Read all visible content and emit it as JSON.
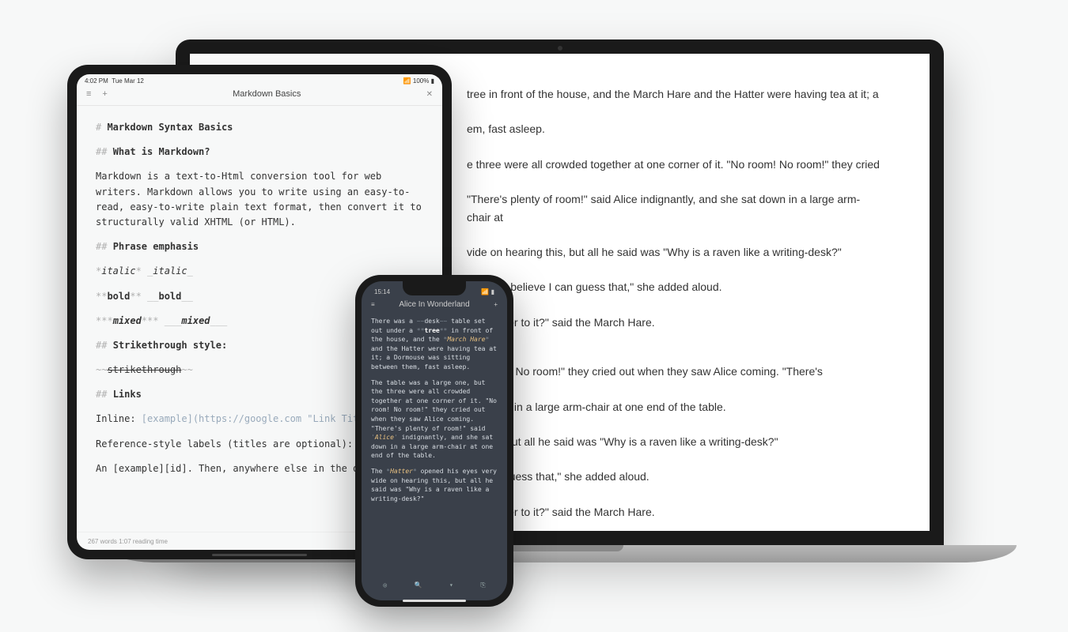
{
  "mac": {
    "p1": "tree in front of the house, and the March Hare and the Hatter were having tea at it; a",
    "p2": "em, fast asleep.",
    "p3": "e three were all crowded together at one corner of it. \"No room! No room!\" they cried",
    "p4": "\"There's plenty of room!\" said Alice indignantly, and she sat down in a large arm-chair at",
    "p5": "vide on hearing this, but all he said was \"Why is a raven like a writing-desk?\"",
    "p6": "ddles—I believe I can guess that,\" she added aloud.",
    "p7": "ne answer to it?\" said the March Hare.",
    "p8": "No room! No room!\" they cried out when they saw Alice coming. \"There's",
    "p9": "sat down in a large arm-chair at one end of the table.",
    "p10": "ng this, but all he said was \"Why is a raven like a writing-desk?\"",
    "p11": "e I can guess that,\" she added aloud.",
    "p12": "ne answer to it?\" said the March Hare."
  },
  "ipad": {
    "status_time": "4:02 PM",
    "status_date": "Tue Mar 12",
    "status_battery": "100%",
    "title": "Markdown Basics",
    "footer": "267 words   1:07 reading time",
    "h1_marker": "# ",
    "h1": "Markdown Syntax Basics",
    "h2a_marker": "## ",
    "h2a": "What is Markdown?",
    "para": "Markdown is a text-to-Html conversion tool for web writers. Markdown allows you to write using an easy-to-read, easy-to-write plain text format, then convert it to structurally valid XHTML (or HTML).",
    "h2b": "Phrase emphasis",
    "em_line_dim1": "*",
    "em_line_it": "italic",
    "em_line_dim2": "*  _",
    "em_line_it2": "italic",
    "em_line_dim3": "_",
    "bold_dim1": "**",
    "bold_txt": "bold",
    "bold_dim2": "**  __",
    "bold_txt2": "bold",
    "bold_dim3": "__",
    "mixed_dim1": "***",
    "mixed_txt": "mixed",
    "mixed_dim2": "***  ___",
    "mixed_txt2": "mixed",
    "mixed_dim3": "___",
    "h2c": "Strikethrough style:",
    "strike_dim1": "~~",
    "strike_txt": "strikethrough",
    "strike_dim2": "~~",
    "h2d": "Links",
    "inline_label": "Inline: ",
    "inline_link": "[example](https://google.com  \"Link Tit",
    "ref_line": "Reference-style labels (titles are optional):",
    "ref_example": "An [example][id]. Then, anywhere else in the do"
  },
  "iphone": {
    "time": "15:14",
    "title": "Alice In Wonderland",
    "body": {
      "p1_a": "There was a ",
      "p1_dim1": "~~",
      "p1_b": "desk",
      "p1_dim2": "~~",
      "p1_c": " table set out under a ",
      "p1_dim3": "**",
      "p1_bold": "tree",
      "p1_dim4": "**",
      "p1_d": " in front of the house, and the ",
      "p1_dim5": "*",
      "p1_em": "March Hare",
      "p1_dim6": "*",
      "p1_e": " and the Hatter were having tea at it; a Dormouse was sitting between them, fast asleep.",
      "p2_a": "The table was a large one, but the three were all crowded together at one corner of it. \"No room! No room!\" they cried out when they saw Alice coming. \"There's plenty of room!\" said ",
      "p2_dim1": "'",
      "p2_em": "Alice",
      "p2_dim2": "'",
      "p2_b": " indignantly, and she sat down in a large arm-chair at one end of the table.",
      "p3_a": "The ",
      "p3_dim1": "*",
      "p3_em": "Hatter",
      "p3_dim2": "*",
      "p3_b": " opened his eyes very wide on hearing this, but all he said was \"Why is a raven like a writing-desk?\""
    }
  }
}
